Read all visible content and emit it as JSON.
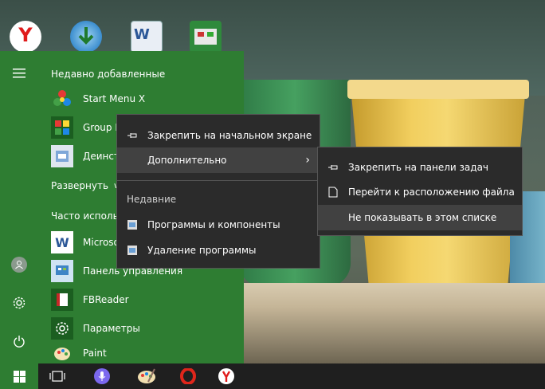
{
  "colors": {
    "start_menu_bg": "#2e7d32",
    "context_menu_bg": "#2b2b2b",
    "context_highlight": "#414141",
    "taskbar_bg": "#1f1f1f"
  },
  "desktop": {
    "icons": [
      "yandex-browser-icon",
      "download-icon",
      "word-document-icon",
      "circuit-board-icon"
    ]
  },
  "start_menu": {
    "recently_added_title": "Недавно добавленные",
    "recent_apps": [
      {
        "label": "Start Menu X",
        "icon": "start-menu-x-icon"
      },
      {
        "label": "Group M",
        "icon": "group-grid-icon"
      },
      {
        "label": "Деинста",
        "icon": "uninstall-icon"
      }
    ],
    "expand_label": "Развернуть",
    "frequent_title": "Часто использу",
    "frequent_apps": [
      {
        "label": "Microso",
        "icon": "word-icon"
      },
      {
        "label": "Панель управления",
        "icon": "control-panel-icon"
      },
      {
        "label": "FBReader",
        "icon": "fbreader-icon"
      },
      {
        "label": "Параметры",
        "icon": "settings-gear-icon"
      },
      {
        "label": "Paint",
        "icon": "paint-icon"
      }
    ]
  },
  "context_menu": {
    "pin_start": "Закрепить на начальном экране",
    "more": "Дополнительно",
    "recent_heading": "Недавние",
    "recent_items": [
      "Программы и компоненты",
      "Удаление программы"
    ]
  },
  "submenu": {
    "pin_taskbar": "Закрепить на панели задач",
    "open_location": "Перейти к расположению файла",
    "hide_from_list": "Не показывать в этом списке"
  },
  "taskbar": {
    "items": [
      "start-button",
      "task-view-button",
      "cortana-mic-button",
      "paint-app-button",
      "opera-app-button",
      "yandex-app-button"
    ]
  }
}
